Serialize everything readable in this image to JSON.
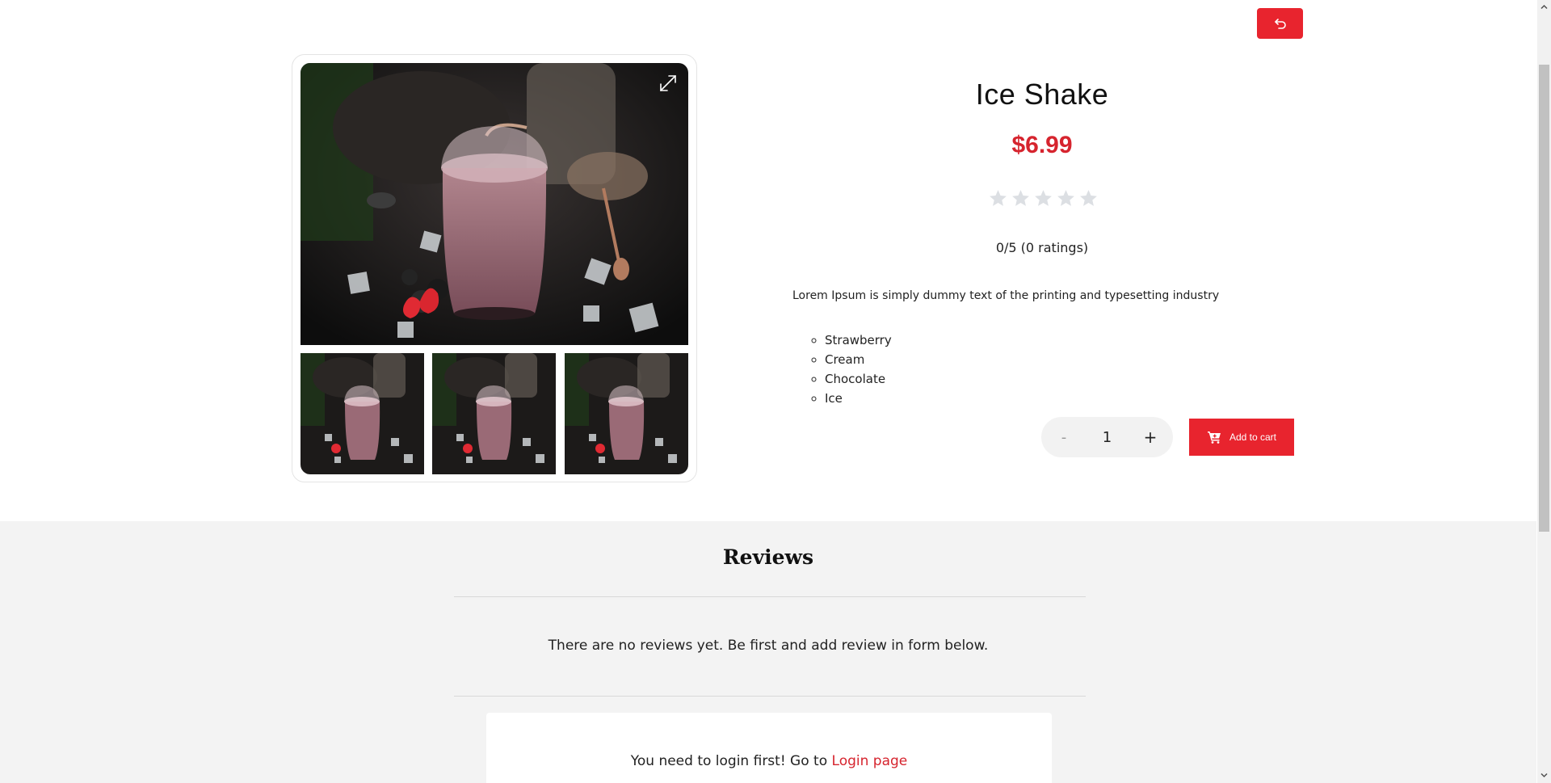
{
  "header": {
    "back_icon": "undo-arrow-icon",
    "accent": "#e8242e"
  },
  "gallery": {
    "expand_icon": "expand-arrows-icon",
    "thumbnail_count": 3
  },
  "product": {
    "title": "Ice Shake",
    "price": "$6.99",
    "price_color": "#d6242e",
    "rating_value": 0,
    "rating_max": 5,
    "rating_text": "0/5 (0 ratings)",
    "description": "Lorem Ipsum is simply dummy text of the printing and typesetting industry",
    "ingredients": [
      "Strawberry",
      "Cream",
      "Chocolate",
      "Ice"
    ]
  },
  "cart": {
    "minus_label": "-",
    "quantity": "1",
    "plus_label": "+",
    "add_label": "Add to cart",
    "cart_icon": "shopping-cart-icon"
  },
  "reviews": {
    "title": "Reviews",
    "empty_message": "There are no reviews yet. Be first and add review in form below.",
    "login_prefix": "You need to login first! Go to ",
    "login_link": "Login page"
  }
}
